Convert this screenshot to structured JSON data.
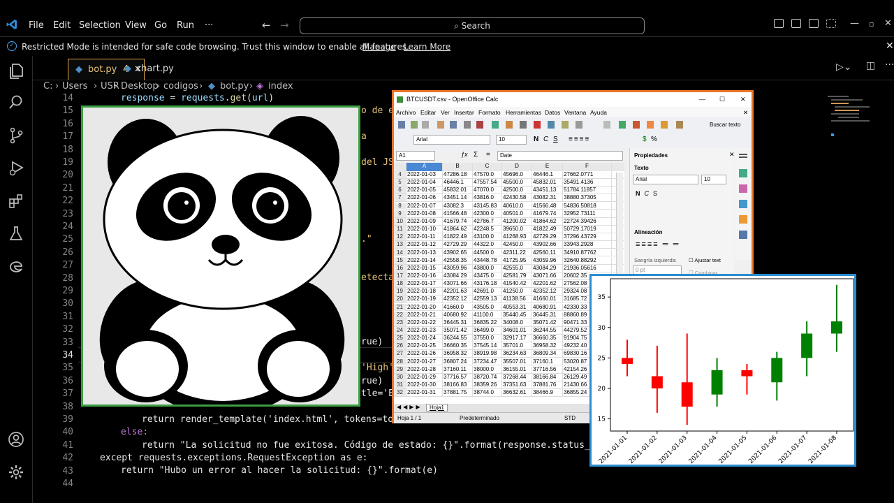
{
  "titlebar": {
    "menu": [
      "File",
      "Edit",
      "Selection",
      "View",
      "Go",
      "Run",
      "···"
    ],
    "search": "Search"
  },
  "banner": {
    "text": "Restricted Mode is intended for safe code browsing. Trust this window to enable all features.",
    "manage": "Manage",
    "learn_more": "Learn More"
  },
  "tabs": [
    {
      "label": "bot.py",
      "badge": "4"
    },
    {
      "label": "chart.py"
    }
  ],
  "breadcrumb": [
    "C:",
    "Users",
    "USR",
    "Desktop",
    "codigos",
    "bot.py",
    "index"
  ],
  "editor": {
    "line_numbers": [
      "14",
      "15",
      "16",
      "17",
      "18",
      "19",
      "20",
      "21",
      "22",
      "23",
      "24",
      "25",
      "26",
      "27",
      "28",
      "29",
      "30",
      "31",
      "32",
      "33",
      "34",
      "35",
      "36",
      "37",
      "38",
      "39",
      "40",
      "41",
      "42",
      "43",
      "44"
    ],
    "l14": "response = requests.get(url)",
    "l15_frag": "o de e",
    "l17_frag": "a",
    "l19_frag": "del JS",
    "l25_frag": ".\"",
    "l28_frag": "etecta",
    "l33_frag": "rue)",
    "l35_frag": "'High'",
    "l36_frag": "rue)",
    "l37_frag": "tle='E",
    "l39": "return render_template('index.html', tokens=toke",
    "l40": "else:",
    "l41": "return \"La solicitud no fue exitosa. Código de estado: {}\".format(response.status_code",
    "l42": "except requests.exceptions.RequestException as e:",
    "l43": "return \"Hubo un error al hacer la solicitud: {}\".format(e)"
  },
  "calc": {
    "title": "BTCUSDT.csv - OpenOffice Calc",
    "menu": [
      "Archivo",
      "Editar",
      "Ver",
      "Insertar",
      "Formato",
      "Herramientas",
      "Datos",
      "Ventana",
      "Ayuda"
    ],
    "buscar": "Buscar texto",
    "font": "Arial",
    "size": "10",
    "cell_ref": "A1",
    "formula": "Date",
    "columns": [
      "A",
      "B",
      "C",
      "D",
      "E",
      "F"
    ],
    "rows": [
      [
        "4",
        "2022-01-03",
        "47286.18",
        "47570.0",
        "45696.0",
        "46446.1",
        "27662.0771"
      ],
      [
        "5",
        "2022-01-04",
        "46446.1",
        "47557.54",
        "45500.0",
        "45832.01",
        "35491.4136"
      ],
      [
        "6",
        "2022-01-05",
        "45832.01",
        "47070.0",
        "42500.0",
        "43451.13",
        "51784.11857"
      ],
      [
        "7",
        "2022-01-06",
        "43451.14",
        "43816.0",
        "42430.58",
        "43082.31",
        "38880.37305"
      ],
      [
        "8",
        "2022-01-07",
        "43082.3",
        "43145.83",
        "40610.0",
        "41566.48",
        "54836.50818"
      ],
      [
        "9",
        "2022-01-08",
        "41566.48",
        "42300.0",
        "40501.0",
        "41679.74",
        "32952.73111"
      ],
      [
        "10",
        "2022-01-09",
        "41679.74",
        "42786.7",
        "41200.02",
        "41864.62",
        "22724.39426"
      ],
      [
        "11",
        "2022-01-10",
        "41864.62",
        "42248.5",
        "39650.0",
        "41822.49",
        "50729.17019"
      ],
      [
        "12",
        "2022-01-11",
        "41822.49",
        "43100.0",
        "41268.93",
        "42729.29",
        "37296.43729"
      ],
      [
        "13",
        "2022-01-12",
        "42729.29",
        "44322.0",
        "42450.0",
        "43902.66",
        "33943.2928"
      ],
      [
        "14",
        "2022-01-13",
        "43902.65",
        "44500.0",
        "42311.22",
        "42560.11",
        "34910.87762"
      ],
      [
        "15",
        "2022-01-14",
        "42558.35",
        "43448.78",
        "41725.95",
        "43059.96",
        "32640.88292"
      ],
      [
        "16",
        "2022-01-15",
        "43059.96",
        "43800.0",
        "42555.0",
        "43084.29",
        "21936.05616"
      ],
      [
        "17",
        "2022-01-16",
        "43084.29",
        "43475.0",
        "42581.79",
        "43071.66",
        "20602.35"
      ],
      [
        "18",
        "2022-01-17",
        "43071.66",
        "43176.18",
        "41540.42",
        "42201.62",
        "27562.08"
      ],
      [
        "19",
        "2022-01-18",
        "42201.63",
        "42691.0",
        "41250.0",
        "42352.12",
        "29324.08"
      ],
      [
        "20",
        "2022-01-19",
        "42352.12",
        "42559.13",
        "41138.56",
        "41660.01",
        "31685.72"
      ],
      [
        "21",
        "2022-01-20",
        "41660.0",
        "43505.0",
        "40553.31",
        "40680.91",
        "42330.33"
      ],
      [
        "22",
        "2022-01-21",
        "40680.92",
        "41100.0",
        "35440.45",
        "36445.31",
        "88860.89"
      ],
      [
        "23",
        "2022-01-22",
        "36445.31",
        "36835.22",
        "34008.0",
        "35071.42",
        "90471.33"
      ],
      [
        "24",
        "2022-01-23",
        "35071.42",
        "36499.0",
        "34601.01",
        "36244.55",
        "44279.52"
      ],
      [
        "25",
        "2022-01-24",
        "36244.55",
        "37550.0",
        "32917.17",
        "36660.35",
        "91904.75"
      ],
      [
        "26",
        "2022-01-25",
        "36660.35",
        "37545.14",
        "35701.0",
        "36958.32",
        "49232.40"
      ],
      [
        "27",
        "2022-01-26",
        "36958.32",
        "38919.98",
        "36234.63",
        "36809.34",
        "69830.16"
      ],
      [
        "28",
        "2022-01-27",
        "36807.24",
        "37234.47",
        "35507.01",
        "37160.1",
        "53020.87"
      ],
      [
        "29",
        "2022-01-28",
        "37160.11",
        "38000.0",
        "36155.01",
        "37716.56",
        "42154.26"
      ],
      [
        "30",
        "2022-01-29",
        "37716.57",
        "38720.74",
        "37268.44",
        "38166.84",
        "26129.49"
      ],
      [
        "31",
        "2022-01-30",
        "38166.83",
        "38359.26",
        "37351.63",
        "37881.76",
        "21430.66"
      ],
      [
        "32",
        "2022-01-31",
        "37881.75",
        "38744.0",
        "36632.61",
        "38466.9",
        "36855.24"
      ]
    ],
    "sheet_tab": "Hoja1",
    "status_page": "Hoja 1 / 1",
    "status_style": "Predeterminado",
    "status_std": "STD",
    "panel_title": "Propiedades",
    "panel_texto": "Texto",
    "panel_font": "Arial",
    "panel_size": "10",
    "panel_alineacion": "Alineación",
    "panel_sangria": "Sangría izquierda:",
    "panel_pt": "0 pt",
    "panel_ajustar": "Ajustar text",
    "panel_combinar": "Combinar"
  },
  "chart_data": {
    "type": "candlestick",
    "categories": [
      "2021-01-01",
      "2021-01-02",
      "2021-01-03",
      "2021-01-04",
      "2021-01-05",
      "2021-01-06",
      "2021-01-07",
      "2021-01-08"
    ],
    "open": [
      25,
      22,
      21,
      19,
      23,
      21,
      25,
      29
    ],
    "high": [
      28,
      27,
      29,
      25,
      24,
      26,
      31,
      37
    ],
    "low": [
      22,
      16,
      14,
      17,
      19,
      18,
      22,
      26
    ],
    "close": [
      24,
      20,
      17,
      23,
      22,
      25,
      29,
      31
    ],
    "colors": {
      "up": "#008000",
      "down": "#ff0000"
    },
    "ylim": [
      13,
      38
    ],
    "yticks": [
      "15",
      "20",
      "25",
      "30",
      "35"
    ],
    "grid": false
  }
}
